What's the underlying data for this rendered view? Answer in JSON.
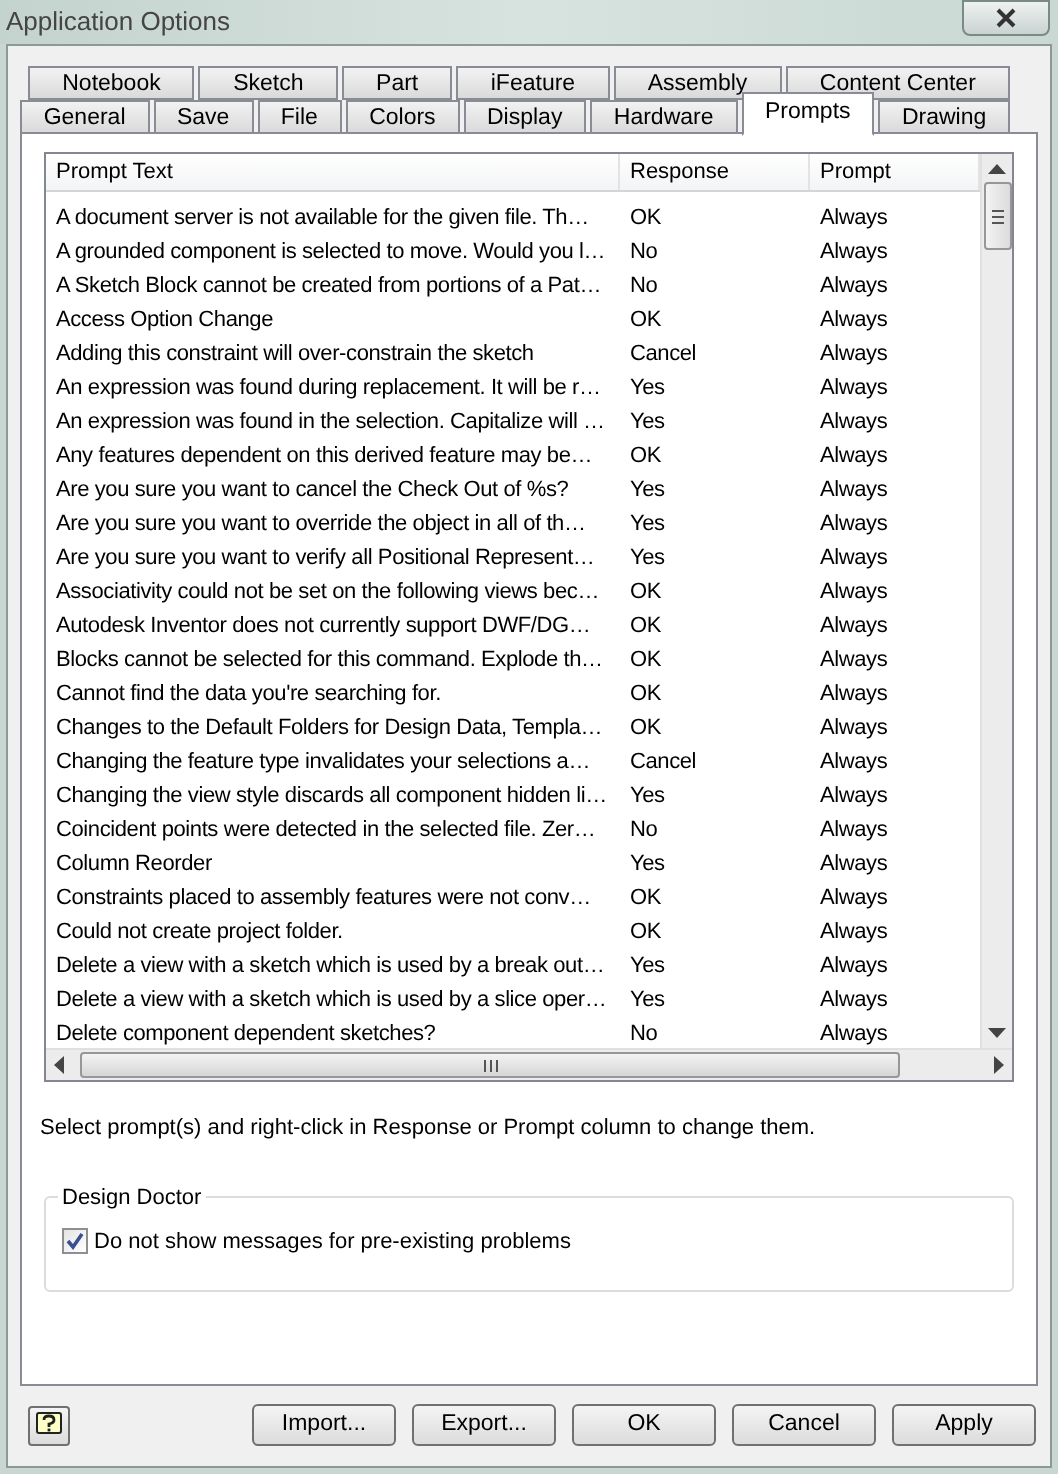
{
  "window": {
    "title": "Application Options"
  },
  "tab_rows": [
    [
      {
        "label": "Notebook",
        "selected": false
      },
      {
        "label": "Sketch",
        "selected": false
      },
      {
        "label": "Part",
        "selected": false
      },
      {
        "label": "iFeature",
        "selected": false
      },
      {
        "label": "Assembly",
        "selected": false
      },
      {
        "label": "Content Center",
        "selected": false
      }
    ],
    [
      {
        "label": "General",
        "selected": false
      },
      {
        "label": "Save",
        "selected": false
      },
      {
        "label": "File",
        "selected": false
      },
      {
        "label": "Colors",
        "selected": false
      },
      {
        "label": "Display",
        "selected": false
      },
      {
        "label": "Hardware",
        "selected": false
      },
      {
        "label": "Prompts",
        "selected": true
      },
      {
        "label": "Drawing",
        "selected": false
      }
    ]
  ],
  "table": {
    "columns": [
      "Prompt Text",
      "Response",
      "Prompt"
    ],
    "rows": [
      [
        "A document server is not available for the given file.  Th…",
        "OK",
        "Always"
      ],
      [
        "A grounded component is selected to move. Would you l…",
        "No",
        "Always"
      ],
      [
        "A Sketch Block cannot be created from portions of a Pat…",
        "No",
        "Always"
      ],
      [
        "Access Option Change",
        "OK",
        "Always"
      ],
      [
        "Adding this constraint will over-constrain the sketch",
        "Cancel",
        "Always"
      ],
      [
        "An expression was found during replacement. It will be r…",
        "Yes",
        "Always"
      ],
      [
        "An expression was found in the selection. Capitalize will …",
        "Yes",
        "Always"
      ],
      [
        "Any features dependent on this derived feature may be…",
        "OK",
        "Always"
      ],
      [
        "Are you sure you want to cancel the Check Out of %s?",
        "Yes",
        "Always"
      ],
      [
        "Are you sure you want to override the object in all of th…",
        "Yes",
        "Always"
      ],
      [
        "Are you sure you want to verify all Positional Represent…",
        "Yes",
        "Always"
      ],
      [
        "Associativity could not be set on the following views bec…",
        "OK",
        "Always"
      ],
      [
        "Autodesk Inventor does not currently support DWF/DG…",
        "OK",
        "Always"
      ],
      [
        "Blocks cannot be selected for this command. Explode th…",
        "OK",
        "Always"
      ],
      [
        "Cannot find the data you're searching for.",
        "OK",
        "Always"
      ],
      [
        "Changes to the Default Folders for Design Data, Templa…",
        "OK",
        "Always"
      ],
      [
        "Changing the feature type invalidates your selections a…",
        "Cancel",
        "Always"
      ],
      [
        "Changing the view style discards all component hidden li…",
        "Yes",
        "Always"
      ],
      [
        "Coincident points were detected in the selected file. Zer…",
        "No",
        "Always"
      ],
      [
        "Column Reorder",
        "Yes",
        "Always"
      ],
      [
        "Constraints placed to assembly features were not conv…",
        "OK",
        "Always"
      ],
      [
        "Could not create project folder.",
        "OK",
        "Always"
      ],
      [
        "Delete a view with a sketch which is used by a break out…",
        "Yes",
        "Always"
      ],
      [
        "Delete a view with a sketch which is used by a slice oper…",
        "Yes",
        "Always"
      ],
      [
        "Delete component dependent sketches?",
        "No",
        "Always"
      ]
    ]
  },
  "hint": "Select prompt(s) and right-click in Response or Prompt column to change them.",
  "design_doctor": {
    "title": "Design Doctor",
    "checkbox": {
      "label": "Do not show messages for pre-existing problems",
      "checked": true
    }
  },
  "buttons": [
    "Import...",
    "Export...",
    "OK",
    "Cancel",
    "Apply"
  ]
}
